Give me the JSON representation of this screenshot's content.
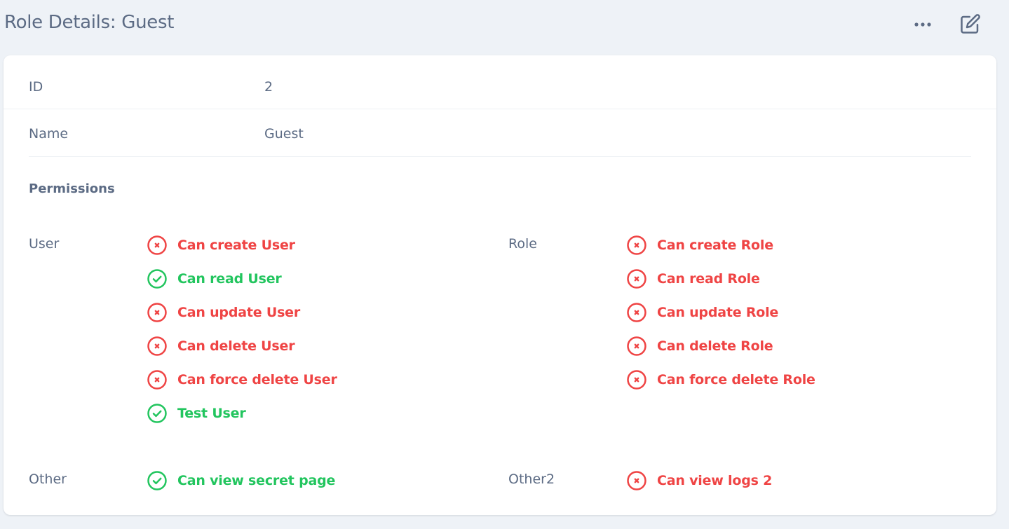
{
  "header": {
    "title": "Role Details: Guest",
    "actions": {
      "more_icon": "ellipsis-icon",
      "edit_icon": "edit-icon"
    }
  },
  "details": {
    "id_label": "ID",
    "id_value": "2",
    "name_label": "Name",
    "name_value": "Guest"
  },
  "permissions": {
    "title": "Permissions",
    "groups": [
      {
        "label": "User",
        "items": [
          {
            "label": "Can create User",
            "granted": false
          },
          {
            "label": "Can read User",
            "granted": true
          },
          {
            "label": "Can update User",
            "granted": false
          },
          {
            "label": "Can delete User",
            "granted": false
          },
          {
            "label": "Can force delete User",
            "granted": false
          },
          {
            "label": "Test User",
            "granted": true
          }
        ]
      },
      {
        "label": "Role",
        "items": [
          {
            "label": "Can create Role",
            "granted": false
          },
          {
            "label": "Can read Role",
            "granted": false
          },
          {
            "label": "Can update Role",
            "granted": false
          },
          {
            "label": "Can delete Role",
            "granted": false
          },
          {
            "label": "Can force delete Role",
            "granted": false
          }
        ]
      },
      {
        "label": "Other",
        "items": [
          {
            "label": "Can view secret page",
            "granted": true
          }
        ]
      },
      {
        "label": "Other2",
        "items": [
          {
            "label": "Can view logs 2",
            "granted": false
          }
        ]
      }
    ]
  },
  "colors": {
    "granted": "#22c55e",
    "denied": "#ef4444",
    "text": "#5c6b84",
    "background": "#eef2f7"
  }
}
